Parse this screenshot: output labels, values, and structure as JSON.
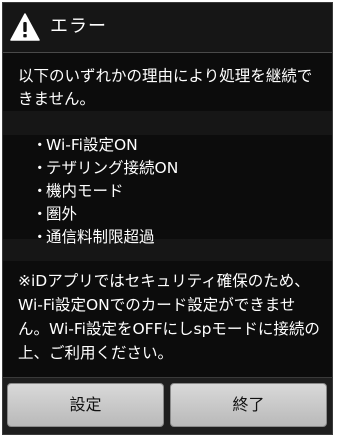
{
  "dialog": {
    "title": "エラー",
    "icon": "warning-icon",
    "message": "以下のいずれかの理由により処理を継続できません。",
    "conditions": [
      "Wi-Fi設定ON",
      "テザリング接続ON",
      "機内モード",
      "圏外",
      "通信料制限超過"
    ],
    "bullet": "・",
    "note": "※iDアプリではセキュリティ確保のため、Wi-Fi設定ONでのカード設定ができません。Wi-Fi設定をOFFにしspモードに接続の上、ご利用ください。"
  },
  "buttons": {
    "settings_label": "設定",
    "exit_label": "終了"
  },
  "colors": {
    "dialog_background": "#0c0c0c",
    "header_background": "#161616",
    "text": "#ffffff",
    "button_face": "#c9c9c9"
  }
}
